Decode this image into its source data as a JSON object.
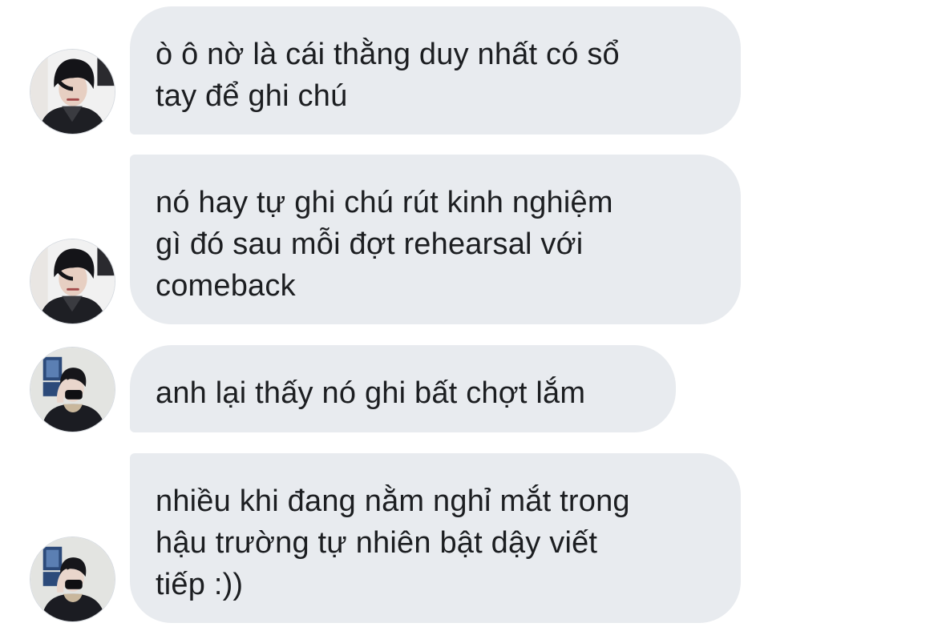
{
  "messages": [
    {
      "sender_avatar": "avatar-dark-hair-boy",
      "lines": [
        "ò ô nờ là cái thằng duy nhất có sổ",
        "tay để ghi chú"
      ]
    },
    {
      "sender_avatar": "avatar-dark-hair-boy",
      "lines": [
        "nó hay tự ghi chú rút kinh nghiệm",
        "gì đó sau mỗi đợt rehearsal với",
        "comeback"
      ]
    },
    {
      "sender_avatar": "avatar-masked-boy",
      "lines": [
        "anh lại thấy nó ghi bất chợt lắm"
      ]
    },
    {
      "sender_avatar": "avatar-masked-boy",
      "lines": [
        "nhiều khi đang nằm nghỉ mắt trong",
        "hậu trường tự nhiên bật dậy viết",
        "tiếp :))"
      ]
    }
  ],
  "colors": {
    "bubble_background": "#e8ebef",
    "text": "#1c1e21",
    "page_background": "#ffffff"
  }
}
